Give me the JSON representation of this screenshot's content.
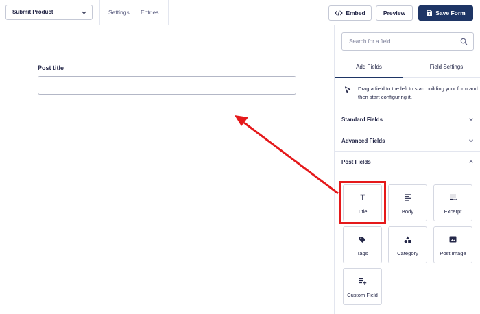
{
  "topbar": {
    "form_select": "Submit Product",
    "links": [
      "Settings",
      "Entries"
    ],
    "embed_label": "Embed",
    "preview_label": "Preview",
    "save_label": "Save Form"
  },
  "canvas": {
    "field_label": "Post title",
    "field_value": ""
  },
  "sidebar": {
    "search_placeholder": "Search for a field",
    "tabs": [
      {
        "label": "Add Fields",
        "active": true
      },
      {
        "label": "Field Settings",
        "active": false
      }
    ],
    "info_text": "Drag a field to the left to start building your form and then start configuring it.",
    "sections": [
      {
        "title": "Standard Fields",
        "state": "collapsed"
      },
      {
        "title": "Advanced Fields",
        "state": "collapsed"
      },
      {
        "title": "Post Fields",
        "state": "expanded"
      }
    ],
    "post_fields": [
      {
        "label": "Title",
        "icon": "text-t-icon"
      },
      {
        "label": "Body",
        "icon": "align-left-icon"
      },
      {
        "label": "Excerpt",
        "icon": "excerpt-icon"
      },
      {
        "label": "Tags",
        "icon": "tag-icon"
      },
      {
        "label": "Category",
        "icon": "shapes-icon"
      },
      {
        "label": "Post Image",
        "icon": "image-icon"
      },
      {
        "label": "Custom Field",
        "icon": "list-add-icon"
      }
    ]
  },
  "colors": {
    "primary": "#1e3565",
    "text": "#242748",
    "highlight": "#e5191b",
    "border": "#e3e6ef"
  }
}
